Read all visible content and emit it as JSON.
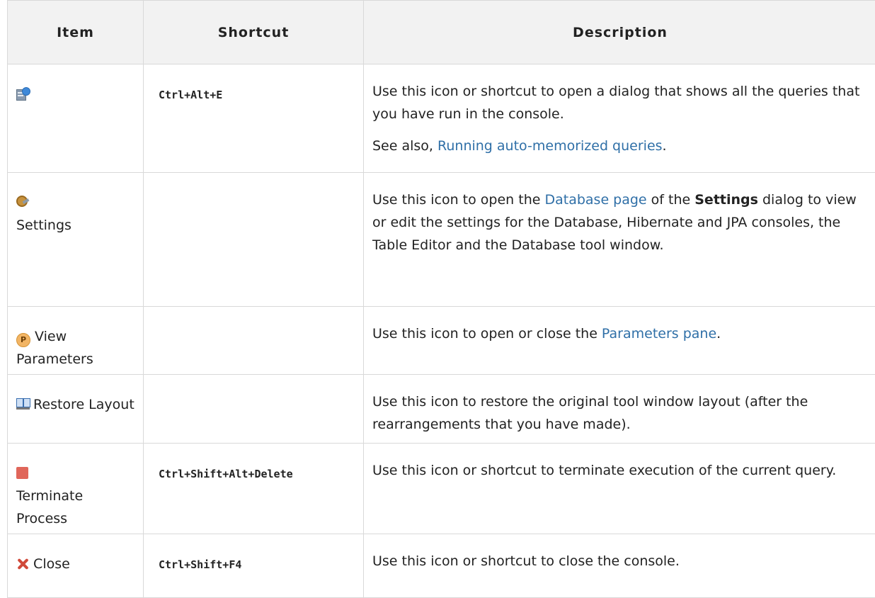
{
  "columns": {
    "item": "Item",
    "shortcut": "Shortcut",
    "description": "Description"
  },
  "rows": [
    {
      "icon": "query-history-icon",
      "item_label": "",
      "shortcut": "Ctrl+Alt+E",
      "desc_p1": "Use this icon or shortcut to open a dialog that shows all the queries that you have run in the console.",
      "desc_p2_prefix": "See also, ",
      "desc_p2_link": "Running auto-memorized queries",
      "desc_p2_suffix": "."
    },
    {
      "icon": "settings-icon",
      "item_label": "Settings",
      "shortcut": "",
      "desc_prefix": "Use this icon to open the ",
      "desc_link": "Database page",
      "desc_mid": " of the ",
      "desc_strong": "Settings",
      "desc_suffix": " dialog to view or edit the settings for the Database, Hibernate and JPA consoles, the Table Editor and the Database tool window."
    },
    {
      "icon": "parameters-icon",
      "item_label": "View Parameters",
      "shortcut": "",
      "desc_prefix": "Use this icon to open or close the ",
      "desc_link": "Parameters pane",
      "desc_suffix": "."
    },
    {
      "icon": "restore-layout-icon",
      "item_label": "Restore Layout",
      "shortcut": "",
      "desc": "Use this icon to restore the original tool window layout (after the rearrangements that you have made)."
    },
    {
      "icon": "terminate-icon",
      "item_label": "Terminate Process",
      "shortcut": "Ctrl+Shift+Alt+Delete",
      "desc": "Use this icon or shortcut to terminate execution of the current query."
    },
    {
      "icon": "close-icon",
      "item_label": "Close",
      "shortcut": "Ctrl+Shift+F4",
      "desc": "Use this icon or shortcut to close the console."
    }
  ],
  "colors": {
    "link": "#2f6fa7",
    "header_bg": "#f2f2f2",
    "border": "#d9d9d9"
  }
}
